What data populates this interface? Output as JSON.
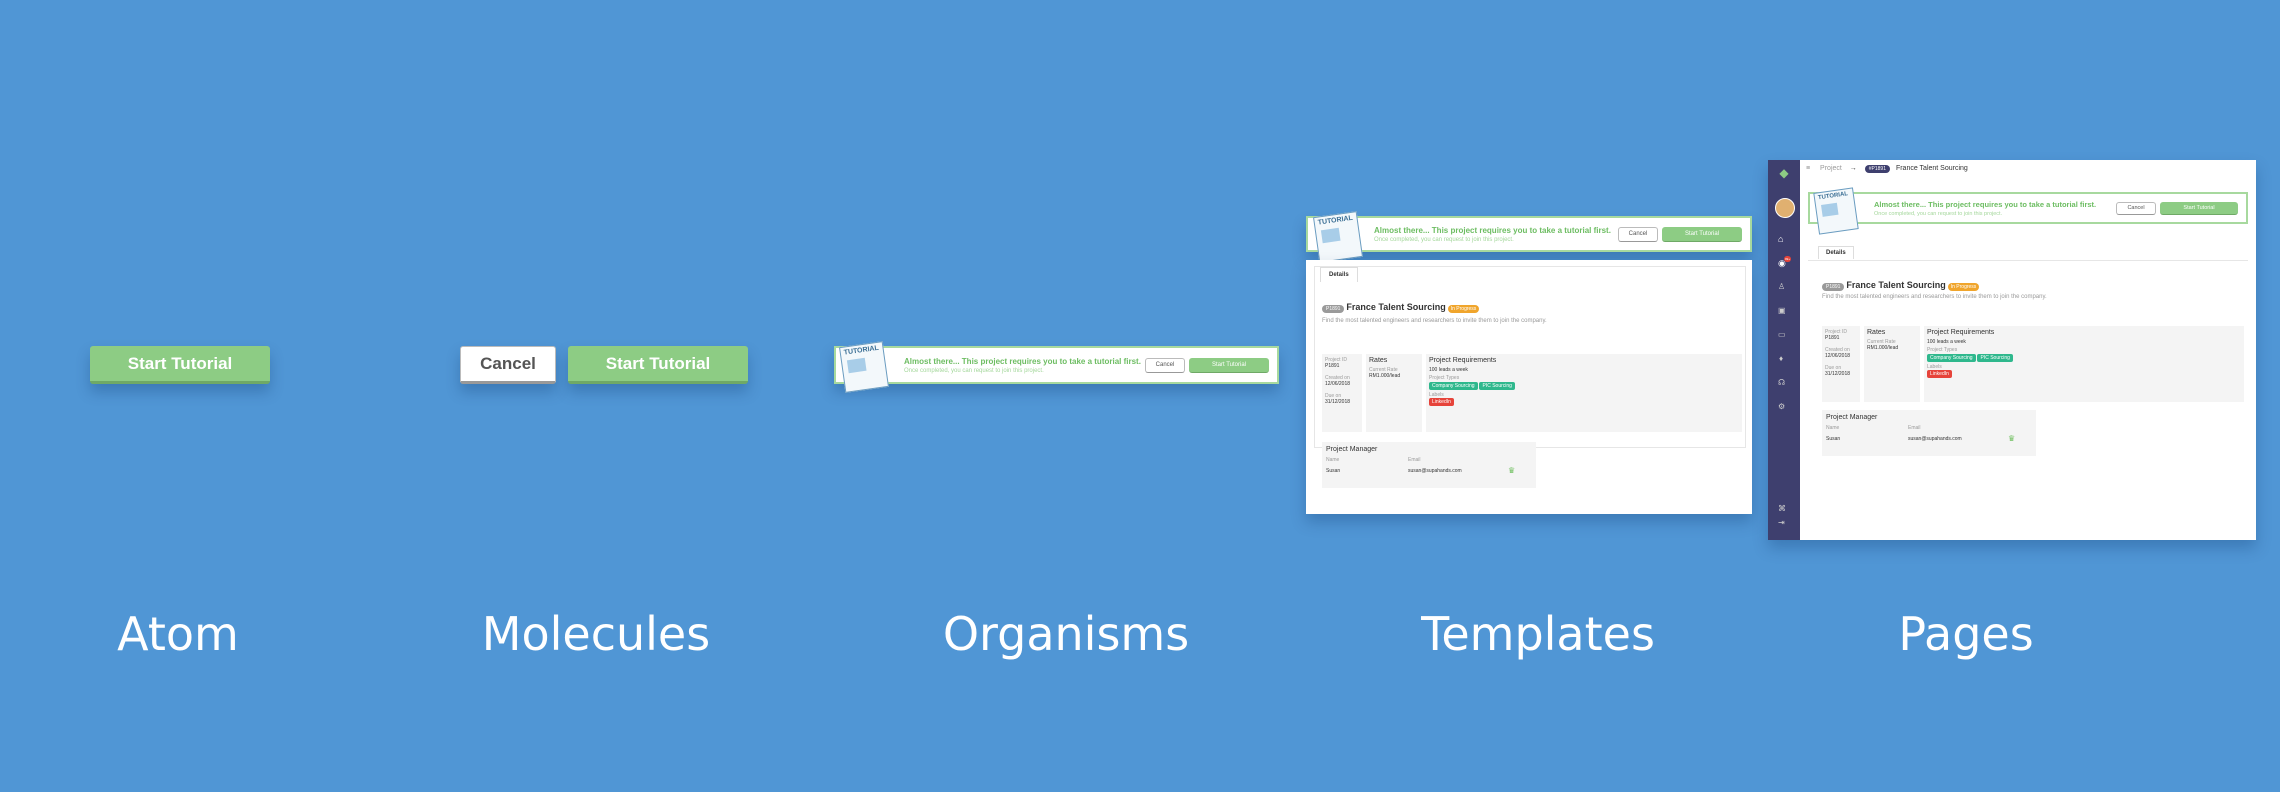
{
  "atom": {
    "start_label": "Start Tutorial"
  },
  "molecules": {
    "cancel_label": "Cancel",
    "start_label": "Start Tutorial"
  },
  "organism": {
    "doc_label": "TUTORIAL",
    "headline": "Almost there... This project requires you to take a tutorial first.",
    "subtext": "Once completed, you can request to join this project.",
    "cancel_label": "Cancel",
    "start_label": "Start Tutorial"
  },
  "template": {
    "banner": {
      "doc_label": "TUTORIAL",
      "headline": "Almost there... This project requires you to take a tutorial first.",
      "subtext": "Once completed, you can request to join this project.",
      "cancel_label": "Cancel",
      "start_label": "Start Tutorial"
    },
    "tab_details": "Details",
    "project": {
      "id_badge": "P1891",
      "title": "France Talent Sourcing",
      "status": "In Progress",
      "description": "Find the most talented engineers and researchers to invite them to join the company."
    },
    "info": {
      "project_id_label": "Project ID",
      "project_id": "P1891",
      "created_label": "Created on",
      "created": "12/06/2018",
      "due_label": "Due on",
      "due": "31/12/2018"
    },
    "rates": {
      "title": "Rates",
      "current_rate_label": "Current Rate",
      "current_rate": "RM1.000/lead"
    },
    "requirements": {
      "title": "Project Requirements",
      "leads": "100 leads a week",
      "types_label": "Project Types",
      "types": [
        "Company Sourcing",
        "PIC Sourcing"
      ],
      "labels_label": "Labels",
      "labels": [
        "LinkedIn"
      ]
    },
    "manager": {
      "title": "Project Manager",
      "name_label": "Name",
      "email_label": "Email",
      "name": "Susan",
      "email": "susan@supahands.com"
    }
  },
  "page": {
    "breadcrumb_project": "Project",
    "breadcrumb_arrow": "→",
    "project_id_pill": "#P1891",
    "breadcrumb_title": "France Talent Sourcing",
    "sidebar_badge": "99+",
    "banner": {
      "doc_label": "TUTORIAL",
      "headline": "Almost there... This project requires you to take a tutorial first.",
      "subtext": "Once completed, you can request to join this project.",
      "cancel_label": "Cancel",
      "start_label": "Start Tutorial"
    },
    "tab_details": "Details",
    "project": {
      "id_badge": "P1891",
      "title": "France Talent Sourcing",
      "status": "In Progress",
      "description": "Find the most talented engineers and researchers to invite them to join the company."
    },
    "info": {
      "project_id_label": "Project ID",
      "project_id": "P1891",
      "created_label": "Created on",
      "created": "12/06/2018",
      "due_label": "Due on",
      "due": "31/12/2018"
    },
    "rates": {
      "title": "Rates",
      "current_rate_label": "Current Rate",
      "current_rate": "RM1.000/lead"
    },
    "requirements": {
      "title": "Project Requirements",
      "leads": "100 leads a week",
      "types_label": "Project Types",
      "types": [
        "Company Sourcing",
        "PIC Sourcing"
      ],
      "labels_label": "Labels",
      "labels": [
        "LinkedIn"
      ]
    },
    "manager": {
      "title": "Project Manager",
      "name_label": "Name",
      "email_label": "Email",
      "name": "Susan",
      "email": "susan@supahands.com"
    }
  },
  "stages": [
    "Atom",
    "Molecules",
    "Organisms",
    "Templates",
    "Pages"
  ],
  "colors": {
    "background": "#5096d5",
    "start_green": "#8dcc84",
    "status_orange": "#f0a52c",
    "tag_green": "#2fb88d",
    "tag_red": "#e6433a",
    "sidebar_purple": "#3e3f6e"
  },
  "icons": [
    "crown-icon",
    "avatar",
    "home-icon",
    "notification-icon",
    "user-icon",
    "briefcase-icon",
    "folder-icon",
    "location-icon",
    "support-icon",
    "settings-icon",
    "grid-icon",
    "logout-icon",
    "menu-icon"
  ]
}
